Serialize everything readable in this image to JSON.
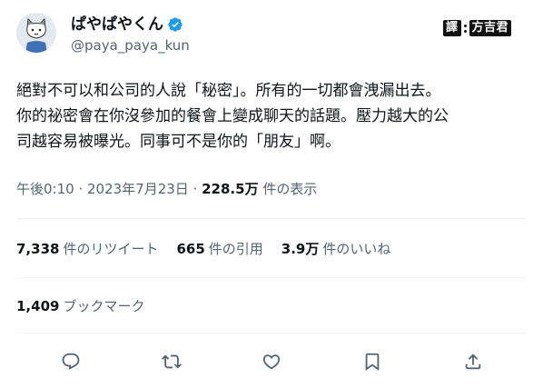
{
  "user": {
    "display_name": "ぱやぱやくん",
    "handle": "@paya_paya_kun",
    "verified": true,
    "verified_color": "#1d9bf0"
  },
  "watermark": {
    "prefix": "譯",
    "name": "方吉君"
  },
  "tweet": {
    "lines": [
      "絕對不可以和公司的人說「秘密」。所有的一切都會洩漏出去。",
      "你的祕密會在你沒參加的餐會上變成聊天的話題。壓力越大的公",
      "司越容易被曝光。同事可不是你的「朋友」啊。"
    ]
  },
  "meta": {
    "time": "午後0:10",
    "sep1": " · ",
    "date": "2023年7月23日",
    "sep2": " · ",
    "views": "228.5万",
    "views_label": " 件の表示"
  },
  "stats": {
    "retweets_count": "7,338",
    "retweets_label": "件のリツイート",
    "quotes_count": "665",
    "quotes_label": "件の引用",
    "likes_count": "3.9万",
    "likes_label": "件のいいね"
  },
  "bookmarks": {
    "count": "1,409",
    "label": "ブックマーク"
  },
  "actions": [
    {
      "icon": "reply-icon"
    },
    {
      "icon": "retweet-icon"
    },
    {
      "icon": "like-icon"
    },
    {
      "icon": "bookmark-icon"
    },
    {
      "icon": "share-icon"
    }
  ],
  "colors": {
    "text": "#0f1419",
    "secondary": "#536471",
    "divider": "#eff3f4"
  }
}
